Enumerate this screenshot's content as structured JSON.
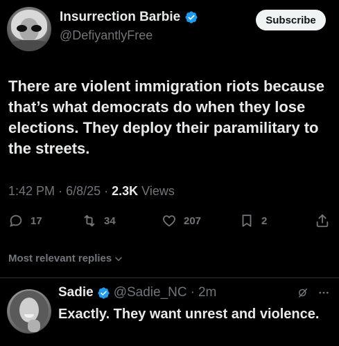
{
  "author": {
    "name": "Insurrection Barbie",
    "handle": "@DefiyantlyFree"
  },
  "subscribe_label": "Subscribe",
  "tweet": {
    "text": "There are violent immigration riots because that’s what democrats do when they lose elections. They deploy their paramilitary to the streets.",
    "time": "1:42 PM",
    "date": "6/8/25",
    "views_count": "2.3K",
    "views_label": "Views"
  },
  "actions": {
    "replies": "17",
    "reposts": "34",
    "likes": "207",
    "bookmarks": "2"
  },
  "sort_label": "Most relevant replies",
  "reply": {
    "name": "Sadie",
    "handle": "@Sadie_NC",
    "time": "2m",
    "text": "Exactly. They want unrest and violence."
  },
  "colors": {
    "background": "#000000",
    "text": "#e7e9ea",
    "secondary": "#71767b",
    "verified": "#1d9bf0",
    "divider": "#2f3336"
  },
  "icons": [
    "verified-badge-icon",
    "reply-icon",
    "repost-icon",
    "like-icon",
    "bookmark-icon",
    "share-icon",
    "chevron-down-icon",
    "grok-icon",
    "more-icon"
  ]
}
